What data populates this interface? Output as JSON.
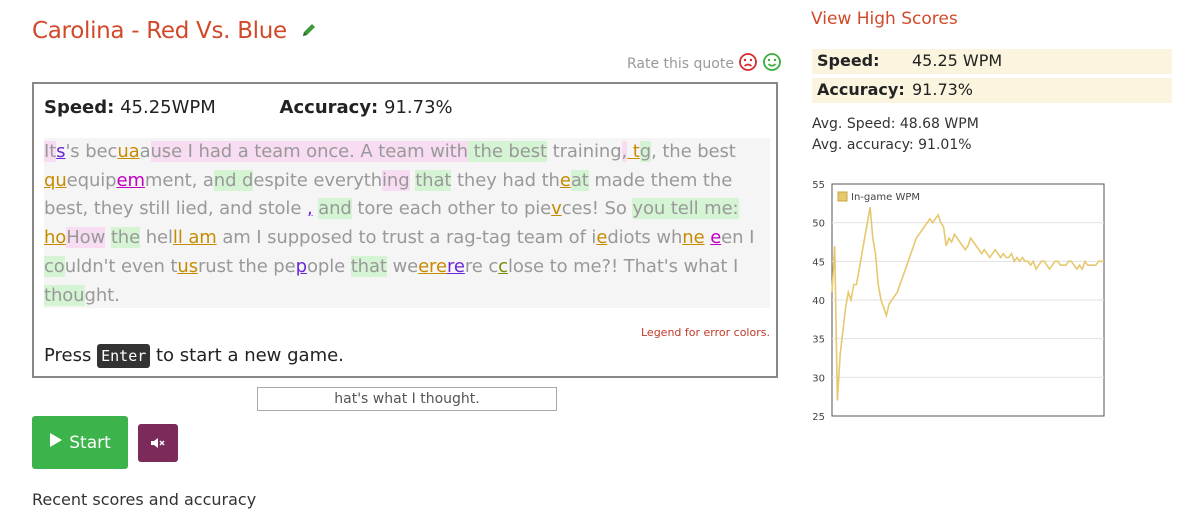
{
  "quote": {
    "title": "Carolina - Red Vs. Blue",
    "rate_label": "Rate this quote"
  },
  "game": {
    "speed_label": "Speed:",
    "speed_value": "45.25WPM",
    "accuracy_label": "Accuracy:",
    "accuracy_value": "91.73%",
    "legend_link": "Legend for error colors.",
    "press_before": "Press",
    "press_key": "Enter",
    "press_after": "to start a new game.",
    "typed_text": "hat's what I thought.",
    "passage_lines": [
      "Its's becuaause I had a team once. A team with the best training, tg, the best",
      "quequipemment, and despite everything that they had theat made them the",
      "best, they still lied, and stole , and tore each other to pievces! So you tell me:",
      "hoHow the helll am am I supposed to trust a rag-tag team of iediots whne een I",
      "couldn't even tusrust the pepople that weererere cclose to me?! That's what I",
      "thought."
    ]
  },
  "controls": {
    "start_label": "Start",
    "start_icon": "play-icon",
    "mute_icon": "speaker-mute-icon"
  },
  "recent": {
    "heading": "Recent scores and accuracy"
  },
  "sidebar": {
    "high_scores_link": "View High Scores",
    "speed_label": "Speed:",
    "speed_value": "45.25 WPM",
    "accuracy_label": "Accuracy:",
    "accuracy_value": "91.73%",
    "avg_speed": "Avg. Speed: 48.68 WPM",
    "avg_accuracy": "Avg. accuracy: 91.01%"
  },
  "colors": {
    "accent": "#d2492a",
    "start_green": "#3cb44b",
    "mute_purple": "#7b2a5a",
    "line_gold": "#e6c86e"
  },
  "chart_data": {
    "type": "line",
    "series": [
      {
        "name": "In-game WPM",
        "x": [
          0,
          1,
          2,
          3,
          4,
          5,
          6,
          7,
          8,
          9,
          10,
          11,
          12,
          13,
          14,
          15,
          16,
          17,
          18,
          19,
          20,
          21,
          22,
          23,
          24,
          25,
          26,
          27,
          28,
          29,
          30,
          31,
          32,
          33,
          34,
          35,
          36,
          37,
          38,
          39,
          40,
          41,
          42,
          43,
          44,
          45,
          46,
          47,
          48,
          49,
          50,
          51,
          52,
          53,
          54,
          55,
          56,
          57,
          58,
          59,
          60,
          61,
          62,
          63,
          64,
          65,
          66,
          67,
          68,
          69,
          70,
          71,
          72,
          73,
          74,
          75,
          76,
          77,
          78,
          79,
          80,
          81,
          82,
          83,
          84,
          85,
          86,
          87,
          88,
          89,
          90,
          91,
          92,
          93,
          94,
          95,
          96,
          97,
          98,
          99,
          100
        ],
        "values": [
          41,
          47,
          27,
          33,
          36,
          39,
          41,
          40,
          42,
          42,
          44,
          46,
          48,
          50,
          52,
          48,
          46,
          42,
          40,
          39,
          38,
          39.5,
          40,
          40.5,
          41,
          42,
          43,
          44,
          45,
          46,
          47,
          48,
          48.5,
          49,
          49.5,
          50,
          50.5,
          50,
          50.5,
          51,
          50,
          49.5,
          47,
          48,
          47.5,
          48.5,
          48,
          47.5,
          47,
          46.5,
          47,
          48,
          47.5,
          47,
          46.5,
          46,
          46.5,
          46,
          45.5,
          46,
          46.5,
          46,
          45.5,
          46,
          45.5,
          45.5,
          46,
          45,
          45.5,
          45,
          45.5,
          45,
          45,
          44.5,
          45,
          44,
          44.5,
          45,
          45,
          44.5,
          44,
          44.5,
          45,
          45,
          44.5,
          44.5,
          44.5,
          45,
          45,
          44.5,
          44,
          44.5,
          44,
          45,
          44.5,
          44.5,
          44.5,
          44.5,
          45,
          45,
          45
        ]
      }
    ],
    "ylim": [
      25,
      55
    ],
    "yticks": [
      25,
      30,
      35,
      40,
      45,
      50,
      55
    ],
    "grid": true,
    "legend": "top-left"
  }
}
